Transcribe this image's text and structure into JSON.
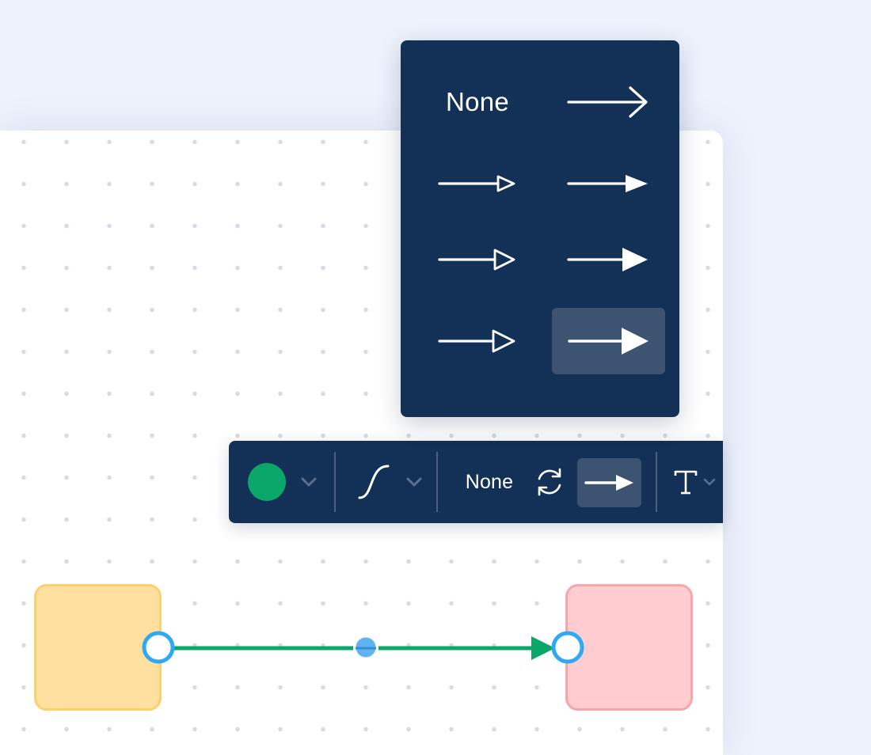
{
  "canvas": {
    "background": "#ffffff",
    "dot_color": "#d7dce4"
  },
  "nodes": [
    {
      "name": "source-node",
      "fill": "#ffe0a0",
      "border": "#fcd06a"
    },
    {
      "name": "target-node",
      "fill": "#ffcdcf",
      "border": "#f6a5a8"
    }
  ],
  "connector": {
    "color": "#0aa66a",
    "handle_color": "#2fa9f5",
    "midpoint_color": "#5fb3ee",
    "end_arrow": "filled-triangle"
  },
  "toolbar": {
    "color_value": "#0aa66a",
    "color_icon": "chevron-down-icon",
    "line_type_icon": "curve-line-icon",
    "start_arrow_label": "None",
    "swap_icon": "swap-arrows-icon",
    "end_arrow_icon": "filled-arrow-icon",
    "text_icon": "text-style-icon"
  },
  "arrow_popup": {
    "options": [
      {
        "label": "None",
        "kind": "none"
      },
      {
        "label": "",
        "kind": "line-arrow"
      },
      {
        "label": "",
        "kind": "hollow-triangle-small"
      },
      {
        "label": "",
        "kind": "filled-triangle-small"
      },
      {
        "label": "",
        "kind": "hollow-triangle-medium"
      },
      {
        "label": "",
        "kind": "filled-triangle-medium"
      },
      {
        "label": "",
        "kind": "hollow-triangle-large"
      },
      {
        "label": "",
        "kind": "filled-triangle-large"
      }
    ],
    "selected_index": 7
  }
}
